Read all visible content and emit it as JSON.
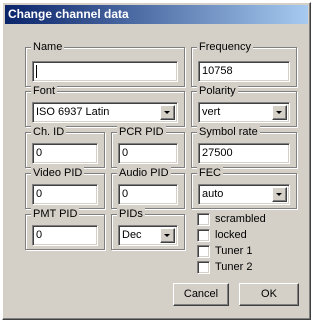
{
  "window": {
    "title": "Change channel data"
  },
  "name": {
    "label": "Name",
    "value": ""
  },
  "frequency": {
    "label": "Frequency",
    "value": "10758"
  },
  "font": {
    "label": "Font",
    "value": "ISO 6937 Latin"
  },
  "polarity": {
    "label": "Polarity",
    "value": "vert"
  },
  "ch_id": {
    "label": "Ch. ID",
    "value": "0"
  },
  "pcr_pid": {
    "label": "PCR PID",
    "value": "0"
  },
  "symbol_rate": {
    "label": "Symbol rate",
    "value": "27500"
  },
  "video_pid": {
    "label": "Video PID",
    "value": "0"
  },
  "audio_pid": {
    "label": "Audio PID",
    "value": "0"
  },
  "fec": {
    "label": "FEC",
    "value": "auto"
  },
  "pmt_pid": {
    "label": "PMT PID",
    "value": "0"
  },
  "pids": {
    "label": "PIDs",
    "value": "Dec"
  },
  "checkboxes": {
    "scrambled": {
      "label": "scrambled",
      "checked": false
    },
    "locked": {
      "label": "locked",
      "checked": false
    },
    "tuner1": {
      "label": "Tuner 1",
      "checked": false
    },
    "tuner2": {
      "label": "Tuner 2",
      "checked": false
    }
  },
  "buttons": {
    "cancel": "Cancel",
    "ok": "OK"
  },
  "colors": {
    "titlebar_start": "#0a246a",
    "titlebar_end": "#a6caf0",
    "face": "#d4d0c8"
  }
}
